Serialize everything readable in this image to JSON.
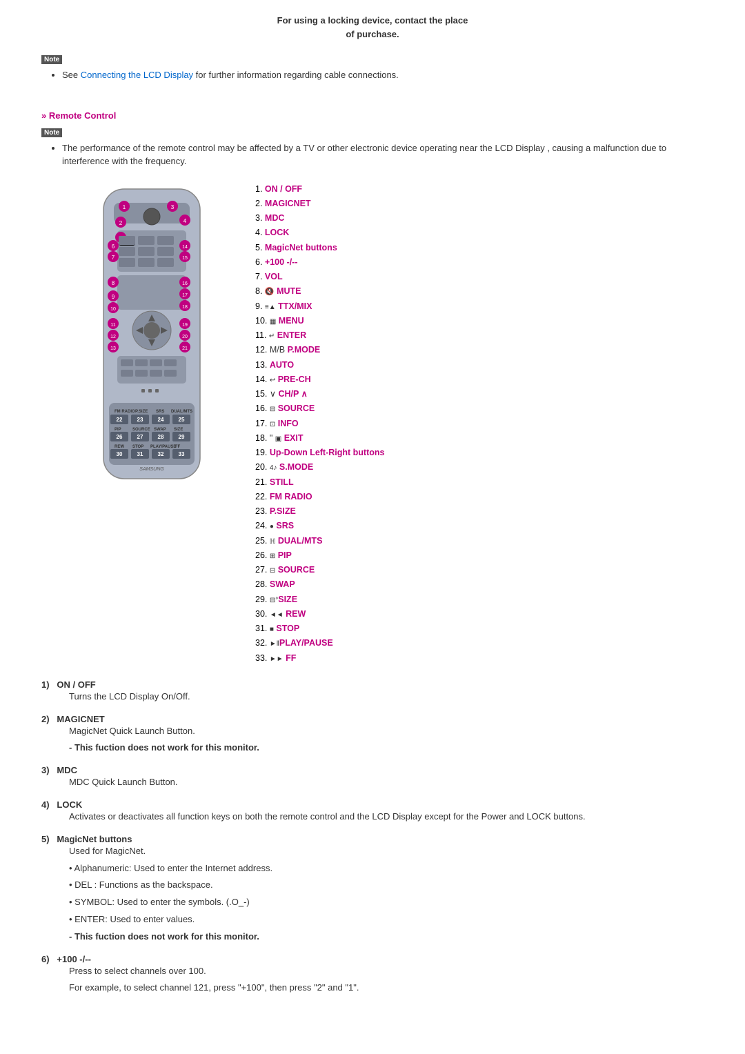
{
  "top_note": {
    "line1": "For using a locking device, contact the place",
    "line2": "of purchase."
  },
  "note1": {
    "icon": "Note",
    "bullet": "See Connecting the LCD Display for further information regarding cable connections."
  },
  "section": {
    "heading": "Remote Control"
  },
  "note2": {
    "icon": "Note",
    "bullet": "The performance of the remote control may be affected by a TV or other electronic device operating near the LCD Display , causing a malfunction due to interference with the frequency."
  },
  "remote_labels": [
    {
      "num": "1.",
      "label": "ON / OFF",
      "type": "magenta"
    },
    {
      "num": "2.",
      "label": "MAGICNET",
      "type": "magenta"
    },
    {
      "num": "3.",
      "label": "MDC",
      "type": "magenta"
    },
    {
      "num": "4.",
      "label": "LOCK",
      "type": "magenta"
    },
    {
      "num": "5.",
      "label": "MagicNet buttons",
      "type": "magenta"
    },
    {
      "num": "6.",
      "label": "+100 -/--",
      "type": "magenta"
    },
    {
      "num": "7.",
      "label": "VOL",
      "type": "magenta"
    },
    {
      "num": "8.",
      "icon": "mute",
      "label": "MUTE",
      "type": "magenta"
    },
    {
      "num": "9.",
      "icon": "ttx",
      "label": "TTX/MIX",
      "type": "magenta"
    },
    {
      "num": "10.",
      "icon": "menu",
      "label": "MENU",
      "type": "magenta"
    },
    {
      "num": "11.",
      "icon": "enter",
      "label": "ENTER",
      "type": "magenta"
    },
    {
      "num": "12.",
      "prefix": "M/B ",
      "label": "P.MODE",
      "type": "magenta"
    },
    {
      "num": "13.",
      "label": "AUTO",
      "type": "magenta"
    },
    {
      "num": "14.",
      "icon": "prech",
      "label": "PRE-CH",
      "type": "magenta"
    },
    {
      "num": "15.",
      "icon": "ch",
      "label": "CH/P ∧",
      "type": "magenta"
    },
    {
      "num": "16.",
      "icon": "source",
      "label": "SOURCE",
      "type": "magenta"
    },
    {
      "num": "17.",
      "icon": "info",
      "label": "INFO",
      "type": "magenta"
    },
    {
      "num": "18.",
      "prefix": "\" ",
      "icon": "exit",
      "label": "EXIT",
      "type": "magenta"
    },
    {
      "num": "19.",
      "label": "Up-Down Left-Right buttons",
      "type": "magenta"
    },
    {
      "num": "20.",
      "icon": "smode",
      "label": "S.MODE",
      "type": "magenta"
    },
    {
      "num": "21.",
      "label": "STILL",
      "type": "magenta"
    },
    {
      "num": "22.",
      "label": "FM RADIO",
      "type": "magenta"
    },
    {
      "num": "23.",
      "label": "P.SIZE",
      "type": "magenta"
    },
    {
      "num": "24.",
      "icon": "srs",
      "label": "SRS",
      "type": "magenta"
    },
    {
      "num": "25.",
      "icon": "dual",
      "label": "DUAL/MTS",
      "type": "magenta"
    },
    {
      "num": "26.",
      "icon": "pip",
      "label": "PIP",
      "type": "magenta"
    },
    {
      "num": "27.",
      "icon": "source2",
      "label": "SOURCE",
      "type": "magenta"
    },
    {
      "num": "28.",
      "label": "SWAP",
      "type": "magenta"
    },
    {
      "num": "29.",
      "icon": "size",
      "label": "SIZE",
      "type": "magenta"
    },
    {
      "num": "30.",
      "icon": "rew",
      "label": "REW",
      "type": "magenta"
    },
    {
      "num": "31.",
      "icon": "stop",
      "label": "STOP",
      "type": "magenta"
    },
    {
      "num": "32.",
      "icon": "play",
      "label": "PLAY/PAUSE",
      "type": "magenta"
    },
    {
      "num": "33.",
      "icon": "ff",
      "label": "FF",
      "type": "magenta"
    }
  ],
  "descriptions": [
    {
      "number": "1)",
      "title": "ON / OFF",
      "body": [
        "Turns the LCD Display On/Off."
      ]
    },
    {
      "number": "2)",
      "title": "MAGICNET",
      "body": [
        "MagicNet Quick Launch Button.",
        "- This fuction does not work for this monitor."
      ],
      "bold_lines": [
        1
      ]
    },
    {
      "number": "3)",
      "title": "MDC",
      "body": [
        "MDC Quick Launch Button."
      ]
    },
    {
      "number": "4)",
      "title": "LOCK",
      "body": [
        "Activates or deactivates all function keys on both the remote control and the LCD Display except for the Power and LOCK buttons."
      ]
    },
    {
      "number": "5)",
      "title": "MagicNet buttons",
      "body": [
        "Used for MagicNet.",
        "• Alphanumeric: Used to enter the Internet address.",
        "• DEL : Functions as the backspace.",
        "• SYMBOL: Used to enter the symbols. (.O_-)",
        "• ENTER: Used to enter values.",
        "- This fuction does not work for this monitor."
      ],
      "bold_lines": [
        5
      ]
    },
    {
      "number": "6)",
      "title": "+100 -/--",
      "body": [
        "Press to select channels over 100.",
        "For example, to select channel 121, press \"+100\", then press \"2\" and \"1\"."
      ]
    }
  ]
}
